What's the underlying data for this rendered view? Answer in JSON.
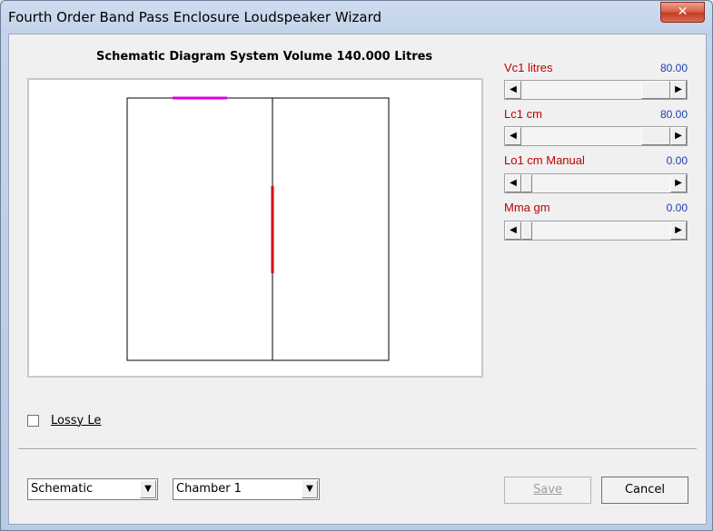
{
  "window": {
    "title": "Fourth Order Band Pass Enclosure Loudspeaker Wizard",
    "close_glyph": "✕"
  },
  "heading": "Schematic Diagram   System Volume 140.000 Litres",
  "params": [
    {
      "label": "Vc1  litres",
      "value": "80.00",
      "position": 0.8
    },
    {
      "label": "Lc1  cm",
      "value": "80.00",
      "position": 0.8
    },
    {
      "label": "Lo1  cm  Manual",
      "value": "0.00",
      "position": 0.0
    },
    {
      "label": "Mma  gm",
      "value": "0.00",
      "position": 0.0
    }
  ],
  "scroll_icons": {
    "left": "◀",
    "right": "▶"
  },
  "lossy": {
    "label": "Lossy Le",
    "checked": false
  },
  "view_select": {
    "value": "Schematic"
  },
  "chamber_select": {
    "value": "Chamber 1"
  },
  "buttons": {
    "save": "Save",
    "cancel": "Cancel"
  },
  "colors": {
    "port": "#e000e0",
    "driver": "#e00000",
    "label": "#c00000",
    "value": "#1a3fb0"
  }
}
